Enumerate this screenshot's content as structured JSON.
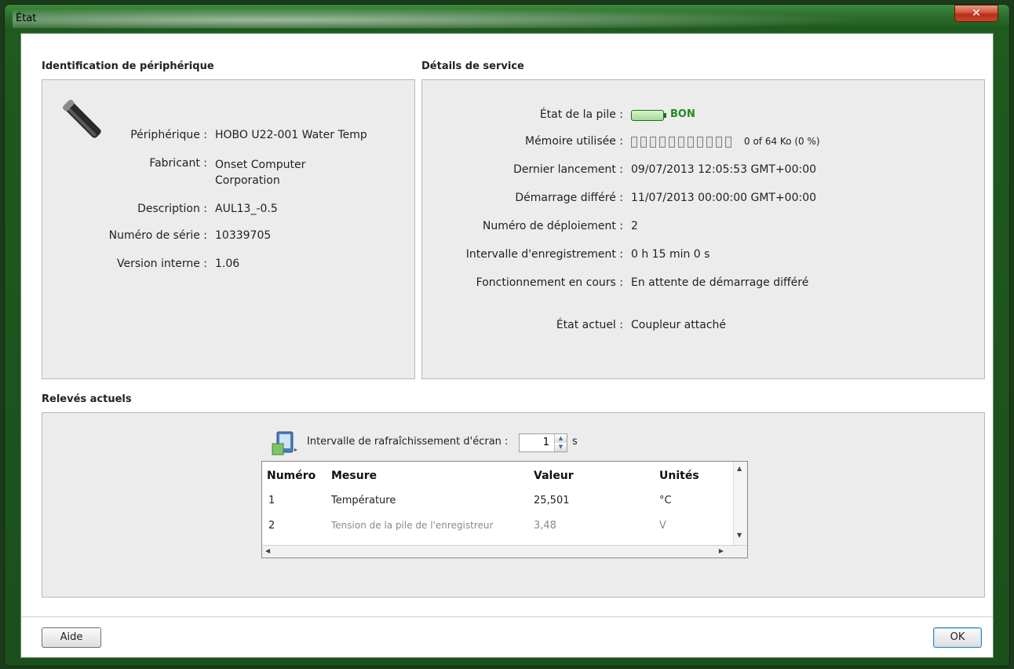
{
  "window": {
    "title": "État"
  },
  "identification": {
    "title": "Identification de périphérique",
    "fields": [
      {
        "label": "Périphérique :",
        "value": "HOBO U22-001 Water Temp"
      },
      {
        "label": "Fabricant :",
        "value": "Onset Computer\nCorporation"
      },
      {
        "label": "Description :",
        "value": "AUL13_-0.5"
      },
      {
        "label": "Numéro de série :",
        "value": "10339705"
      },
      {
        "label": "Version interne :",
        "value": "1.06"
      }
    ]
  },
  "service": {
    "title": "Détails de service",
    "battery": {
      "label": "État de la pile :",
      "status": "BON",
      "color": "#1f8a1f"
    },
    "memory": {
      "label": "Mémoire utilisée :",
      "value": "0 of 64 Ko (0 %)",
      "used_fraction": 0
    },
    "fields": [
      {
        "label": "Dernier lancement :",
        "value": "09/07/2013 12:05:53 GMT+00:00"
      },
      {
        "label": "Démarrage différé :",
        "value": "11/07/2013 00:00:00 GMT+00:00"
      },
      {
        "label": "Numéro de déploiement :",
        "value": "2"
      },
      {
        "label": "Intervalle d'enregistrement :",
        "value": "0 h 15 min 0 s"
      },
      {
        "label": "Fonctionnement en cours :",
        "value": "En attente de démarrage différé"
      },
      {
        "label": "État actuel :",
        "value": "Coupleur attaché"
      }
    ]
  },
  "readings": {
    "title": "Relevés actuels",
    "refresh_label": "Intervalle de rafraîchissement d'écran :",
    "refresh_value": "1",
    "refresh_unit": "s",
    "columns": [
      "Numéro",
      "Mesure",
      "Valeur",
      "Unités"
    ],
    "rows": [
      {
        "num": "1",
        "measure": "Température",
        "value": "25,501",
        "unit": "°C"
      },
      {
        "num": "2",
        "measure": "Tension de la pile de l'enregistreur",
        "value": "3,48",
        "unit": "V"
      }
    ]
  },
  "buttons": {
    "help": "Aide",
    "ok": "OK"
  }
}
